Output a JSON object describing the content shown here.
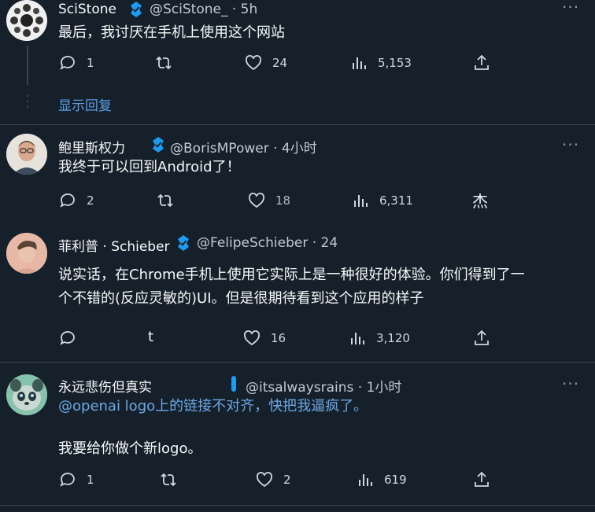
{
  "tweets": [
    {
      "name": "SciStone",
      "handle": "@SciStone_ · 5h",
      "text_lines": [
        "最后，我讨厌在手机上使用这个网站"
      ],
      "replies": "1",
      "likes": "24",
      "views": "5,153",
      "show_replies": "显示回复"
    },
    {
      "name": "鲍里斯权力",
      "handle": "@BorisMPower · 4小时",
      "text_lines": [
        "我终于可以回到Android了！"
      ],
      "replies": "2",
      "likes": "18",
      "views": "6,311",
      "extra": "杰"
    },
    {
      "name": "菲利普 · Schieber",
      "handle": "@FelipeSchieber · 24",
      "text_lines": [
        "说实话，在Chrome手机上使用它实际上是一种很好的体验。你们得到了一",
        "个不错的(反应灵敏的)UI。但是很期待看到这个应用的样子"
      ],
      "replies": "",
      "retweet_label": "t",
      "likes": "16",
      "views": "3,120"
    },
    {
      "name": "永远悲伤但真实",
      "handle": "@itsalwaysrains · 1小时",
      "mention_line": "@openai logo上的链接不对齐，快把我逼疯了。",
      "text_lines": [
        "我要给你做个新logo。"
      ],
      "replies": "1",
      "likes": "2",
      "views": "619"
    }
  ],
  "colors": {
    "background": "#15202b",
    "accent": "#1d9bf0",
    "muted": "#8b98a5"
  },
  "icons": [
    "reply-icon",
    "retweet-icon",
    "like-icon",
    "views-icon",
    "share-icon",
    "verified-badge-icon",
    "more-icon"
  ]
}
